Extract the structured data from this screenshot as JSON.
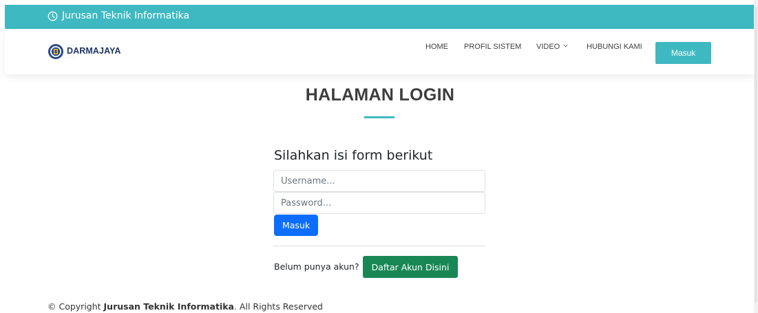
{
  "topbar": {
    "text": "Jurusan Teknik Informatika",
    "icon": "clock-icon"
  },
  "header": {
    "logo_brand": "DARMAJAYA",
    "menu": [
      {
        "label": "HOME"
      },
      {
        "label": "PROFIL SISTEM"
      },
      {
        "label": "VIDEO",
        "has_dropdown": true
      },
      {
        "label": "HUBUNGI KAMI"
      }
    ],
    "login_button": "Masuk"
  },
  "main": {
    "title": "HALAMAN LOGIN",
    "form_heading": "Silahkan isi form berikut",
    "username_placeholder": "Username...",
    "password_placeholder": "Password...",
    "submit_label": "Masuk",
    "register_prompt": "Belum punya akun?",
    "register_button": "Daftar Akun Disini"
  },
  "footer": {
    "prefix": "© Copyright ",
    "org": "Jurusan Teknik Informatika",
    "suffix": ". All Rights Reserved"
  },
  "colors": {
    "accent": "#3fb9c1",
    "primary_button": "#0d6efd",
    "success_button": "#198754"
  }
}
